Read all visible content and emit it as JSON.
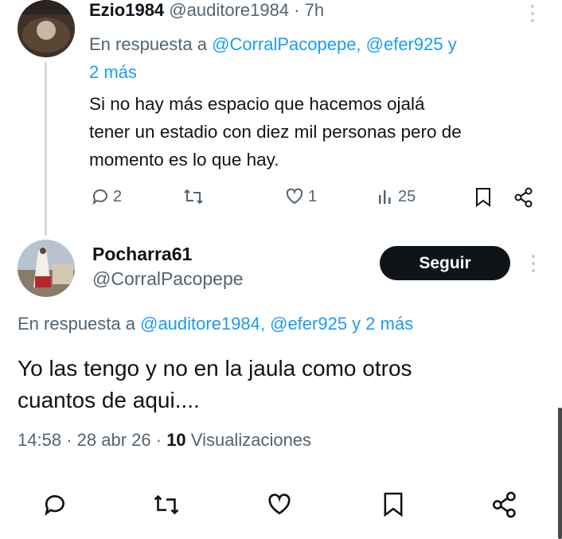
{
  "reply_tweet": {
    "display_name": "Ezio1984",
    "handle": "@auditore1984",
    "separator": "·",
    "time": "7h",
    "reply_prefix": "En respuesta a",
    "reply_mentions": "@CorralPacopepe, @efer925 y",
    "reply_more": "2 más",
    "text_line1": "Si no hay más espacio que hacemos ojalá",
    "text_line2": "tener un estadio con diez mil personas pero de",
    "text_line3": "momento es lo que hay.",
    "actions": {
      "replies": "2",
      "likes": "1",
      "views": "25"
    }
  },
  "main_tweet": {
    "display_name": "Pocharra61",
    "handle": "@CorralPacopepe",
    "follow_label": "Seguir",
    "reply_prefix": "En respuesta a",
    "reply_mentions": "@auditore1984, @efer925 y 2 más",
    "text_line1": "Yo las tengo y no en la jaula como otros",
    "text_line2": "cuantos de aqui....",
    "meta_time": "14:58",
    "meta_sep1": "·",
    "meta_date": "28 abr 26",
    "meta_sep2": "·",
    "meta_views_count": "10",
    "meta_views_label": "Visualizaciones"
  },
  "icons": [
    "reply-icon",
    "retweet-icon",
    "like-icon",
    "views-icon",
    "bookmark-icon",
    "share-icon",
    "more-icon"
  ]
}
